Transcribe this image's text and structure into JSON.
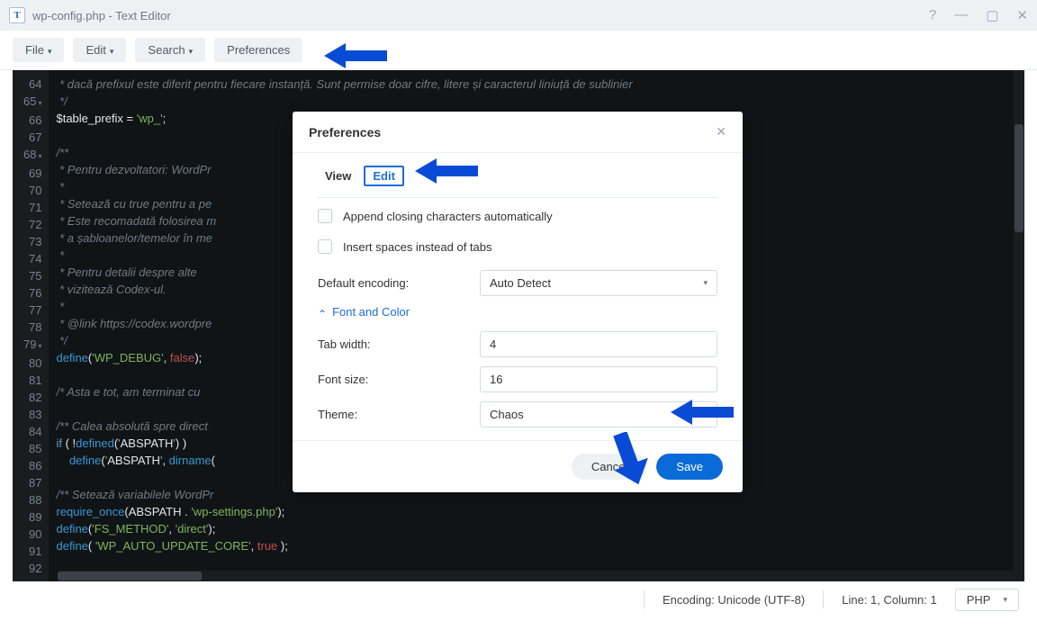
{
  "window": {
    "title": "wp-config.php - Text Editor"
  },
  "toolbar": {
    "file": "File",
    "edit": "Edit",
    "search": "Search",
    "preferences": "Preferences"
  },
  "gutter": {
    "start": 64,
    "end": 92,
    "fold_lines": [
      65,
      68,
      79
    ]
  },
  "code_lines": [
    {
      "t": "com",
      "text": " * dacă prefixul este diferit pentru fiecare instanță. Sunt permise doar cifre, litere și caracterul liniuță de sublinier"
    },
    {
      "t": "com",
      "text": " */"
    },
    {
      "raw": true,
      "html": "$table_prefix = 'wp_';"
    },
    {
      "t": "blank",
      "text": ""
    },
    {
      "t": "com",
      "text": "/**"
    },
    {
      "t": "com",
      "text": " * Pentru dezvoltatori: WordPr"
    },
    {
      "t": "com",
      "text": " *"
    },
    {
      "t": "com",
      "text": " * Setează cu true pentru a pe"
    },
    {
      "t": "com",
      "text": " * Este recomadată folosirea m"
    },
    {
      "t": "com",
      "text": " * a șabloanelor/temelor în me"
    },
    {
      "t": "com",
      "text": " *"
    },
    {
      "t": "com",
      "text": " * Pentru detalii despre alte "
    },
    {
      "t": "com",
      "text": " * vizitează Codex-ul."
    },
    {
      "t": "com",
      "text": " *"
    },
    {
      "t": "com",
      "text": " * @link https://codex.wordpre"
    },
    {
      "t": "com",
      "text": " */"
    },
    {
      "raw": true,
      "html": "define('WP_DEBUG', false);"
    },
    {
      "t": "blank",
      "text": ""
    },
    {
      "t": "com",
      "text": "/* Asta e tot, am terminat cu "
    },
    {
      "t": "blank",
      "text": ""
    },
    {
      "t": "com",
      "text": "/** Calea absolută spre direct"
    },
    {
      "raw": true,
      "html": "if ( !defined('ABSPATH') )"
    },
    {
      "raw": true,
      "html": "    define('ABSPATH', dirname("
    },
    {
      "t": "blank",
      "text": ""
    },
    {
      "t": "com",
      "text": "/** Setează variabilele WordPr"
    },
    {
      "raw": true,
      "html": "require_once(ABSPATH . 'wp-settings.php');"
    },
    {
      "raw": true,
      "html": "define('FS_METHOD', 'direct');"
    },
    {
      "raw": true,
      "html": "define( 'WP_AUTO_UPDATE_CORE', true );"
    },
    {
      "t": "blank",
      "text": ""
    }
  ],
  "status": {
    "encoding": "Encoding: Unicode (UTF-8)",
    "position": "Line: 1, Column: 1",
    "language": "PHP"
  },
  "modal": {
    "title": "Preferences",
    "tabs": {
      "view": "View",
      "edit": "Edit"
    },
    "append_closing": "Append closing characters automatically",
    "insert_spaces": "Insert spaces instead of tabs",
    "default_encoding_label": "Default encoding:",
    "default_encoding_value": "Auto Detect",
    "font_color_section": "Font and Color",
    "tab_width_label": "Tab width:",
    "tab_width_value": "4",
    "font_size_label": "Font size:",
    "font_size_value": "16",
    "theme_label": "Theme:",
    "theme_value": "Chaos",
    "cancel": "Cancel",
    "save": "Save"
  }
}
